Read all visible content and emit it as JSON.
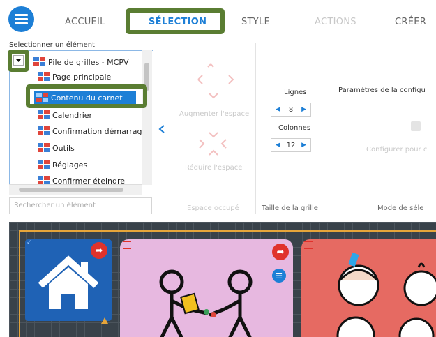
{
  "header": {
    "tabs": [
      {
        "label": "ACCUEIL"
      },
      {
        "label": "SÉLECTION"
      },
      {
        "label": "STYLE"
      },
      {
        "label": "ACTIONS"
      },
      {
        "label": "CRÉER"
      }
    ]
  },
  "selection_panel": {
    "title": "Selectionner un élément",
    "tree": {
      "root": "Pile de grilles - MCPV",
      "items": [
        "Page principale",
        "Contenu du carnet",
        "Calendrier",
        "Confirmation démarrage",
        "Outils",
        "Réglages",
        "Confirmer éteindre"
      ]
    },
    "search_placeholder": "Rechercher un élément"
  },
  "space_panel": {
    "increase_label": "Augmenter l'espace",
    "reduce_label": "Réduire l'espace",
    "footer": "Espace occupé"
  },
  "grid_size_panel": {
    "rows_label": "Lignes",
    "rows_value": "8",
    "cols_label": "Colonnes",
    "cols_value": "12",
    "footer": "Taille de la grille"
  },
  "mode_panel": {
    "title": "Paramètres de la configu",
    "configure_label": "Configurer pour c",
    "footer": "Mode de séle"
  },
  "colors": {
    "accent": "#1d7fd6",
    "highlight_frame": "#5a7d32",
    "canvas": "#39424a",
    "cell_blue": "#1f62b5",
    "cell_pink": "#e7b8e0",
    "cell_red": "#e66a62",
    "grid_border": "#e6a53a"
  },
  "icons": [
    "menu-icon",
    "expand-arrow-icon",
    "collapse-arrow-icon",
    "grid-stack-icon",
    "share-arrow-icon",
    "menu-lines-icon",
    "house-icon"
  ]
}
